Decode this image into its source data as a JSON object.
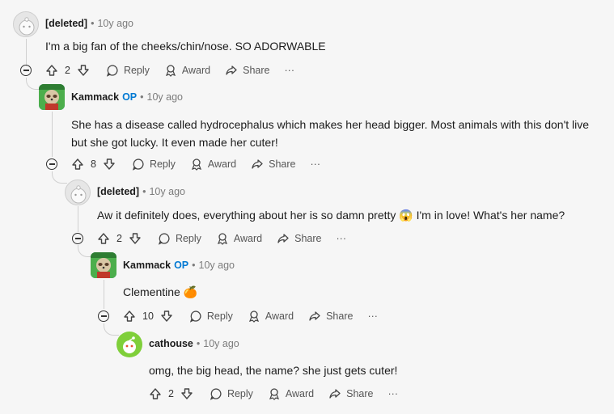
{
  "comments": [
    {
      "author": "[deleted]",
      "time": "10y ago",
      "text": "I'm a big fan of the cheeks/chin/nose. SO ADORWABLE",
      "votes": "2"
    },
    {
      "author": "Kammack",
      "op_label": "OP",
      "time": "10y ago",
      "text_line1": "She has a disease called hydrocephalus which makes her head bigger. Most animals with this don't live",
      "text_line2": "but she got lucky. It even made her cuter!",
      "votes": "8"
    },
    {
      "author": "[deleted]",
      "time": "10y ago",
      "text_before": "Aw it definitely does, everything about her is so damn pretty",
      "emoji": "😱",
      "text_after": "I'm in love! What's her name?",
      "votes": "2"
    },
    {
      "author": "Kammack",
      "op_label": "OP",
      "time": "10y ago",
      "text": "Clementine",
      "emoji": "🍊",
      "votes": "10"
    },
    {
      "author": "cathouse",
      "time": "10y ago",
      "text": "omg, the big head, the name? she just gets cuter!",
      "votes": "2"
    }
  ],
  "actions": {
    "reply": "Reply",
    "award": "Award",
    "share": "Share",
    "more": "···"
  },
  "separator": "•",
  "colors": {
    "op": "#0079d3",
    "thread_line": "#d0d0d0",
    "background": "#f6f6f6"
  }
}
